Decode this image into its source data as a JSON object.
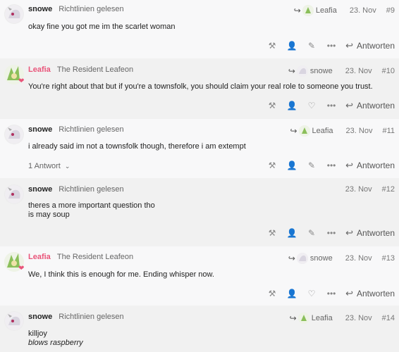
{
  "posts": [
    {
      "username": "snowe",
      "title": "Richtlinien gelesen",
      "reply_to": "Leafia",
      "date": "23. Nov",
      "number": "#9",
      "lines": [
        "okay fine you got me im the scarlet woman"
      ],
      "reply_label": "Antworten"
    },
    {
      "username": "Leafia",
      "title": "The Resident Leafeon",
      "reply_to": "snowe",
      "date": "23. Nov",
      "number": "#10",
      "lines": [
        "You're right about that but if you're a townsfolk, you should claim your real role to someone you trust."
      ],
      "reply_label": "Antworten"
    },
    {
      "username": "snowe",
      "title": "Richtlinien gelesen",
      "reply_to": "Leafia",
      "date": "23. Nov",
      "number": "#11",
      "lines": [
        "i already said im not a townsfolk though, therefore i am extempt"
      ],
      "replies_count": "1 Antwort",
      "reply_label": "Antworten"
    },
    {
      "username": "snowe",
      "title": "Richtlinien gelesen",
      "date": "23. Nov",
      "number": "#12",
      "lines": [
        "theres a more important question tho",
        "is may soup"
      ],
      "reply_label": "Antworten"
    },
    {
      "username": "Leafia",
      "title": "The Resident Leafeon",
      "reply_to": "snowe",
      "date": "23. Nov",
      "number": "#13",
      "lines": [
        "We, I think this is enough for me. Ending whisper now."
      ],
      "reply_label": "Antworten"
    },
    {
      "username": "snowe",
      "title": "Richtlinien gelesen",
      "reply_to": "Leafia",
      "date": "23. Nov",
      "number": "#14",
      "lines": [
        "killjoy",
        "blows raspberry"
      ],
      "reply_label": "Antworten"
    }
  ],
  "icons": {
    "moderator": "hammer-icon",
    "user": "user-icon",
    "edit": "pencil-icon",
    "more": "ellipsis-icon",
    "like": "heart-icon",
    "reply": "reply-arrow-icon"
  },
  "colors": {
    "leafia_name": "#e9557a",
    "grey_band": "#f1f1f1"
  }
}
